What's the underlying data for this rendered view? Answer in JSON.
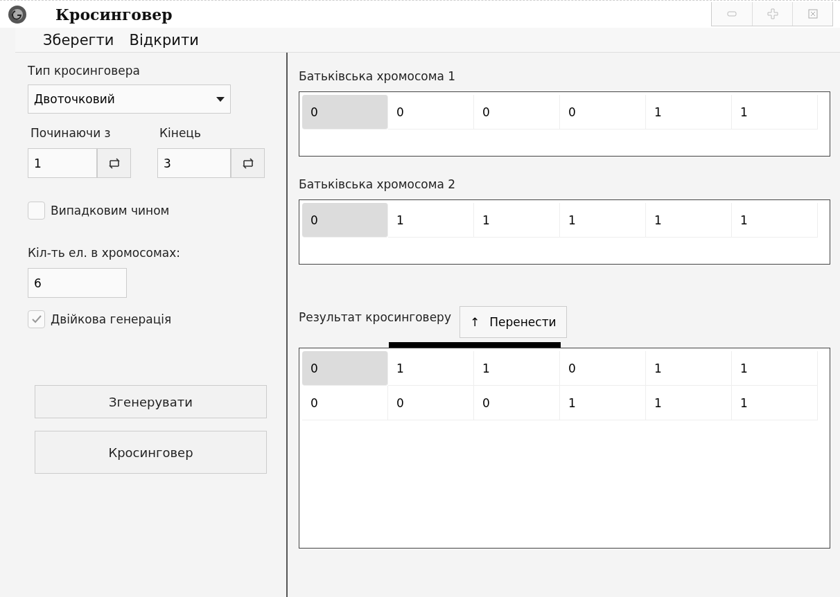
{
  "window": {
    "title": "Кросинговер"
  },
  "menu": [
    "Зберегти",
    "Відкрити"
  ],
  "left": {
    "type_label": "Тип кросинговера",
    "type_value": "Двоточковий",
    "start": {
      "label": "Починаючи з",
      "value": "1"
    },
    "end": {
      "label": "Кінець",
      "value": "3"
    },
    "random": {
      "label": "Випадковим чином",
      "checked": false
    },
    "count_label": "Кіл-ть ел. в хромосомах:",
    "count_value": "6",
    "binary": {
      "label": "Двійкова генерація",
      "checked": true
    },
    "buttons": [
      "Згенерувати",
      "Кросинговер"
    ]
  },
  "parent1": {
    "title": "Батьківська хромосома 1",
    "rows": [
      [
        {
          "value": "0",
          "selected": true
        },
        {
          "value": "0",
          "selected": false
        },
        {
          "value": "0",
          "selected": false
        },
        {
          "value": "0",
          "selected": false
        },
        {
          "value": "1",
          "selected": false
        },
        {
          "value": "1",
          "selected": false
        }
      ]
    ]
  },
  "parent2": {
    "title": "Батьківська хромосома 2",
    "rows": [
      [
        {
          "value": "0",
          "selected": true
        },
        {
          "value": "1",
          "selected": false
        },
        {
          "value": "1",
          "selected": false
        },
        {
          "value": "1",
          "selected": false
        },
        {
          "value": "1",
          "selected": false
        },
        {
          "value": "1",
          "selected": false
        }
      ]
    ]
  },
  "result": {
    "title": "Результат кросинговеру",
    "button_icon": "↑",
    "button": "Перенести",
    "rows": [
      [
        {
          "value": "0",
          "selected": true
        },
        {
          "value": "1",
          "selected": false
        },
        {
          "value": "1",
          "selected": false
        },
        {
          "value": "0",
          "selected": false
        },
        {
          "value": "1",
          "selected": false
        },
        {
          "value": "1",
          "selected": false
        }
      ],
      [
        {
          "value": "0",
          "selected": false
        },
        {
          "value": "0",
          "selected": false
        },
        {
          "value": "0",
          "selected": false
        },
        {
          "value": "1",
          "selected": false
        },
        {
          "value": "1",
          "selected": false
        },
        {
          "value": "1",
          "selected": false
        }
      ]
    ]
  }
}
